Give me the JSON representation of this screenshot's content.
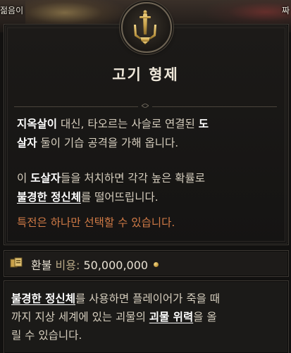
{
  "top": {
    "left_label": "젊음이",
    "right_label": "짜"
  },
  "panel": {
    "icon_name": "sword-trident-icon",
    "title": "고기 형제",
    "desc1": {
      "t1": "지옥살이",
      "t2": " 대신, 타오르는 사슬로 연결된 ",
      "t3": "도",
      "t4": "살자",
      "t5": " 둘이 기습 공격을 가해 옵니다."
    },
    "desc2": {
      "t1": "이 ",
      "t2": "도살자",
      "t3": "들을 처치하면 각각 높은 확률로",
      "t4": "불경한 정신체",
      "t5": "를 떨어뜨립니다."
    },
    "warning": "특전은 하나만 선택할 수 있습니다."
  },
  "refund": {
    "icon_name": "refund-icon",
    "label": "환불 ",
    "cost_label": "비용:",
    "amount": " 50,000,000",
    "coin_icon": "gold-coin-icon"
  },
  "tooltip": {
    "t1": "불경한 정신체",
    "t2": "를 사용하면 플레이어가 죽을 때",
    "t3": "까지 지상 세계에 있는 괴물의 ",
    "t4": "괴물 위력",
    "t5": "을 올",
    "t6": "릴 수 있습니다."
  },
  "colors": {
    "accent_gold": "#d6b25c",
    "warning_orange": "#d07a46",
    "text_body": "#d6cebe"
  }
}
